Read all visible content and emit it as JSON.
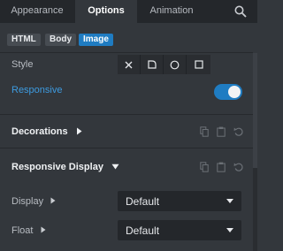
{
  "tabs": [
    {
      "label": "Appearance",
      "active": false
    },
    {
      "label": "Options",
      "active": true
    },
    {
      "label": "Animation",
      "active": false
    }
  ],
  "search_icon": "search-icon",
  "context": [
    {
      "label": "HTML",
      "active": false
    },
    {
      "label": "Body",
      "active": false
    },
    {
      "label": "Image",
      "active": true
    }
  ],
  "style": {
    "label": "Style",
    "options": [
      "none-icon",
      "rounded-corner-icon",
      "circle-icon",
      "square-icon"
    ]
  },
  "responsive": {
    "label": "Responsive",
    "enabled": true
  },
  "decorations": {
    "title": "Decorations",
    "icons": [
      "copy-icon",
      "paste-icon",
      "reset-icon"
    ]
  },
  "responsive_display": {
    "title": "Responsive Display",
    "icons": [
      "copy-icon",
      "paste-icon",
      "reset-icon"
    ],
    "display": {
      "label": "Display",
      "value": "Default"
    },
    "float": {
      "label": "Float",
      "value": "Default"
    }
  },
  "colors": {
    "accent": "#1f7cc2",
    "background": "#33373c",
    "tab_bar": "#24272b"
  }
}
